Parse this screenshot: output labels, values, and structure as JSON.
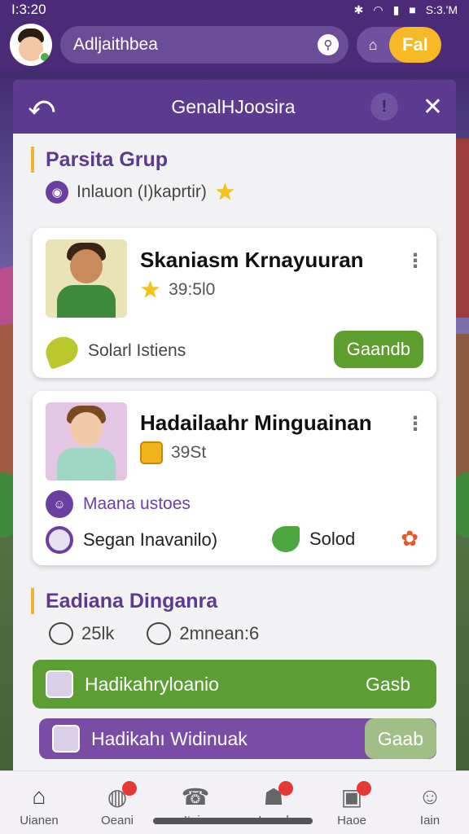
{
  "status": {
    "time": "I:3:20",
    "clock_right": "S:3.'M"
  },
  "topbar": {
    "search_text": "Adljaithbea",
    "pill_label": "Fal"
  },
  "panel": {
    "title": "GenalHJoosira",
    "section1": {
      "title": "Parsita Grup",
      "subtitle": "Inlauon (I)kaprtir)"
    },
    "cards": [
      {
        "title": "Skaniasm Krnayuuran",
        "score": "39:5l0",
        "bottom_text": "Solarl Istiens",
        "button": "Gaandb"
      },
      {
        "title": "Hadailaahr Minguainan",
        "score": "39St",
        "line1": "Maana ustoes",
        "line2": "Segan Inavanilo)",
        "line2_right": "Solod"
      }
    ],
    "section2": {
      "title": "Eadiana Dinganra",
      "stat1": "25lk",
      "stat2": "2mnean:6"
    },
    "bars": [
      {
        "label": "Hadikahryloanio",
        "action": "Gasb"
      },
      {
        "label": "Hadikahı Widinuak",
        "action": "Gaab"
      }
    ]
  },
  "nav": [
    {
      "label": "Uianen",
      "icon": "home-icon"
    },
    {
      "label": "Oeani",
      "icon": "chat-icon"
    },
    {
      "label": "Itaiu",
      "icon": "phone-icon"
    },
    {
      "label": "Ieranl",
      "icon": "group-icon"
    },
    {
      "label": "Haoe",
      "icon": "inbox-icon"
    },
    {
      "label": "Iain",
      "icon": "profile-icon"
    }
  ],
  "colors": {
    "purple": "#5b3a8f",
    "green": "#5e9e2f",
    "yellow": "#f7b924"
  }
}
